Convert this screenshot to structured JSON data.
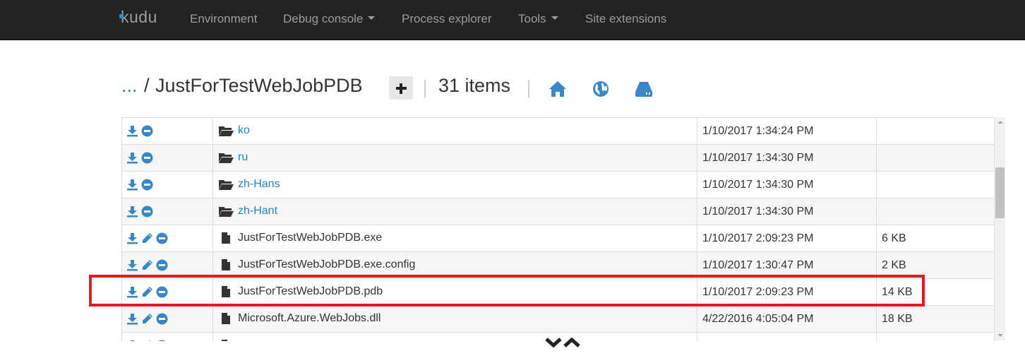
{
  "navbar": {
    "brand": "kudu",
    "items": [
      {
        "label": "Environment",
        "dropdown": false
      },
      {
        "label": "Debug console",
        "dropdown": true
      },
      {
        "label": "Process explorer",
        "dropdown": false
      },
      {
        "label": "Tools",
        "dropdown": true
      },
      {
        "label": "Site extensions",
        "dropdown": false
      }
    ]
  },
  "path": {
    "ellipsis": "...",
    "separator": "/",
    "folder": "JustForTestWebJobPDB",
    "item_count": "31 items",
    "icons": [
      "plus-icon",
      "home-icon",
      "globe-icon",
      "hdd-icon"
    ]
  },
  "files": {
    "rows": [
      {
        "type": "dir",
        "name": "ko",
        "modified": "1/10/2017 1:34:24 PM",
        "size": ""
      },
      {
        "type": "dir",
        "name": "ru",
        "modified": "1/10/2017 1:34:30 PM",
        "size": ""
      },
      {
        "type": "dir",
        "name": "zh-Hans",
        "modified": "1/10/2017 1:34:30 PM",
        "size": ""
      },
      {
        "type": "dir",
        "name": "zh-Hant",
        "modified": "1/10/2017 1:34:30 PM",
        "size": ""
      },
      {
        "type": "file",
        "name": "JustForTestWebJobPDB.exe",
        "modified": "1/10/2017 2:09:23 PM",
        "size": "6 KB"
      },
      {
        "type": "file",
        "name": "JustForTestWebJobPDB.exe.config",
        "modified": "1/10/2017 1:30:47 PM",
        "size": "2 KB"
      },
      {
        "type": "file",
        "name": "JustForTestWebJobPDB.pdb",
        "modified": "1/10/2017 2:09:23 PM",
        "size": "14 KB",
        "highlighted": true
      },
      {
        "type": "file",
        "name": "Microsoft.Azure.WebJobs.dll",
        "modified": "4/22/2016 4:05:04 PM",
        "size": "18 KB"
      },
      {
        "type": "file",
        "name": "",
        "modified": "",
        "size": ""
      }
    ]
  },
  "colors": {
    "navbar_bg": "#222222",
    "nav_text": "#9d9d9d",
    "link": "#2a7fc2",
    "icon_blue": "#3a87c8",
    "highlight_border": "#e01b22"
  },
  "footer": {
    "icons": [
      "chevron-down-icon",
      "chevron-up-icon"
    ]
  }
}
